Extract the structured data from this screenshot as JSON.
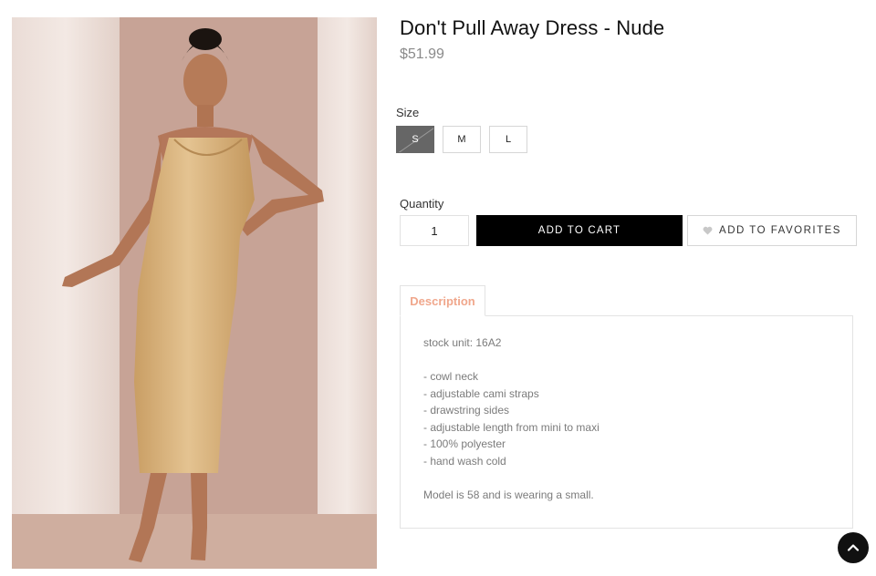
{
  "product": {
    "title": "Don't Pull Away Dress - Nude",
    "price": "$51.99",
    "image_alt": "Model wearing nude satin slip dress"
  },
  "size": {
    "label": "Size",
    "options": [
      "S",
      "M",
      "L"
    ],
    "selected": "S"
  },
  "quantity": {
    "label": "Quantity",
    "value": "1"
  },
  "actions": {
    "add_to_cart": "ADD TO CART",
    "add_to_favorites": "ADD TO FAVORITES"
  },
  "description": {
    "tab_label": "Description",
    "stock_unit": "stock unit: 16A2",
    "bullets": [
      "- cowl neck",
      "- adjustable cami straps",
      "- drawstring sides",
      "- adjustable length from mini to maxi",
      "- 100% polyester",
      "- hand wash cold"
    ],
    "model_note": "Model is 58 and is wearing a small."
  },
  "colors": {
    "accent_tab": "#f0a78c",
    "cart_button": "#000000",
    "selected_size": "#666666",
    "dress": "#dcb784",
    "backdrop": "#c7a396"
  },
  "icons": {
    "favorite": "heart-icon",
    "scroll_top": "chevron-up-icon"
  }
}
